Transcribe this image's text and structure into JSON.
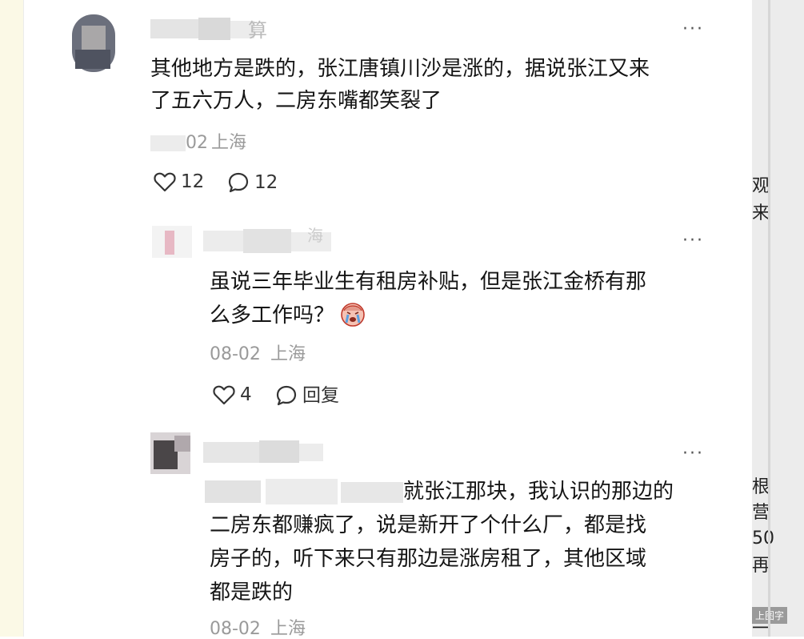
{
  "comments": [
    {
      "username_tail": "算",
      "text_lines": [
        "其他地方是跌的，张江唐镇川沙是涨的，据说张江又来",
        "了五六万人，二房东嘴都笑裂了"
      ],
      "date_tail": "02",
      "location": "上海",
      "likes": "12",
      "replies": "12"
    },
    {
      "username_tail": "海",
      "text_lines": [
        "虽说三年毕业生有租房补贴，但是张江金桥有那",
        "么多工作吗？"
      ],
      "emoji": "crying-face-icon",
      "date": "08-02",
      "location": "上海",
      "likes": "4",
      "reply_label": "回复"
    },
    {
      "text_lines": [
        "就张江那块，我认识的那边的",
        "二房东都赚疯了，说是新开了个什么厂，都是找",
        "房子的，听下来只有那边是涨房租了，其他区域",
        "都是跌的"
      ],
      "date": "08-02",
      "location": "上海"
    }
  ],
  "more_label": "···",
  "side_panel": {
    "fragments": [
      "观",
      "来",
      "根",
      "营",
      "50",
      "再",
      "一"
    ],
    "corner_label": "上图字"
  },
  "colors": {
    "text": "#151515",
    "meta": "#9a9a9a",
    "icon": "#333333",
    "panel": "#ececec",
    "gutter": "#fbf9e6"
  }
}
